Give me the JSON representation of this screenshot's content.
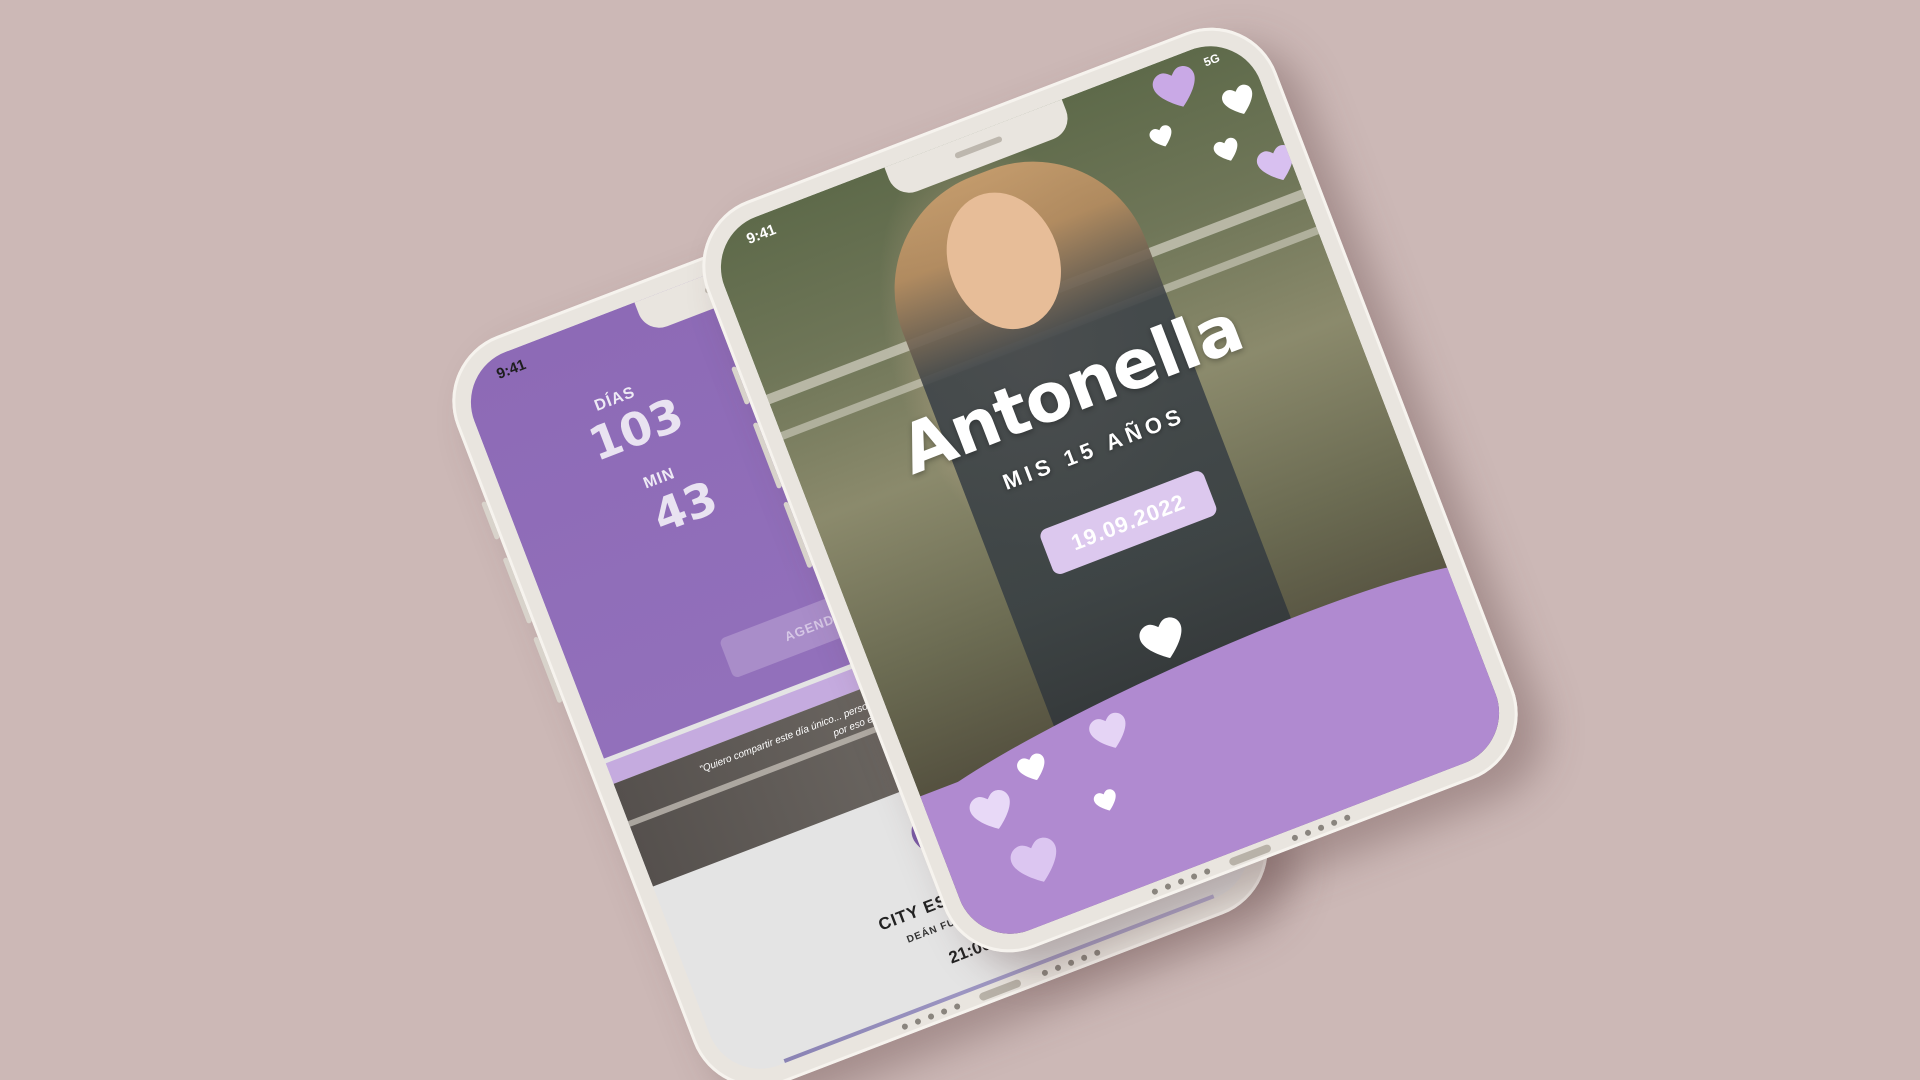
{
  "back_phone": {
    "status_time": "9:41",
    "days_label": "DÍAS",
    "days_value": "103",
    "min_label": "MIN",
    "min_value": "43",
    "button_label": "AGENDAR LA FI",
    "quote": "\"Quiero compartir este día único... personas que me apoyan en... una de ellas, por eso estas i...",
    "venue_name": "CITY ESPACIO DE E",
    "venue_address": "DEÁN FUNES 3750, CÓR",
    "event_time": "21:00 HS"
  },
  "front_phone": {
    "status_time": "9:41",
    "status_signal": "5G",
    "name": "Antonella",
    "subtitle": "MIS 15 AÑOS",
    "date": "19.09.2022"
  },
  "colors": {
    "background": "#ccb8b6",
    "purple": "#9270bb",
    "lilac": "#b08ad0",
    "date_pill": "#dcc8ee",
    "phone_body": "#e9e5df"
  },
  "icons": [
    "location-pin-icon",
    "heart-icon"
  ]
}
